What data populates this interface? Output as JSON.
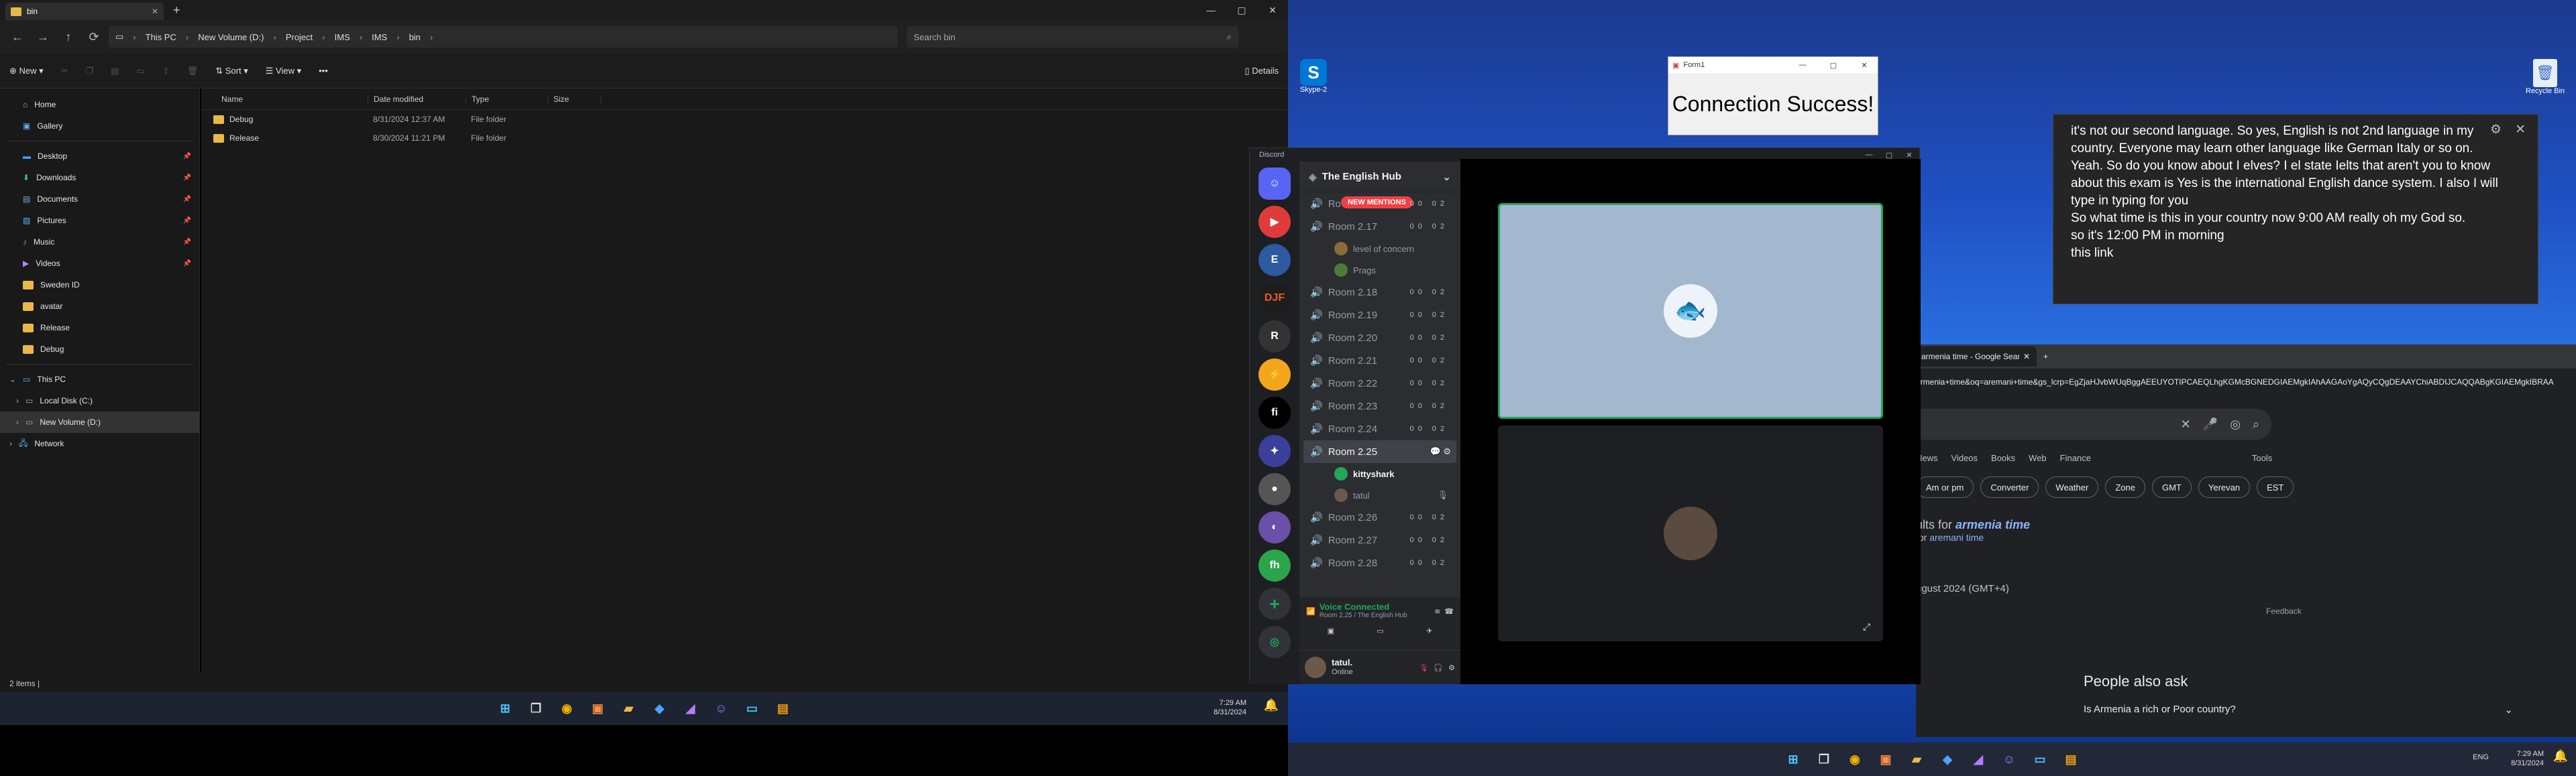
{
  "explorer": {
    "tab_title": "bin",
    "breadcrumbs": [
      "This PC",
      "New Volume (D:)",
      "Project",
      "IMS",
      "IMS",
      "bin"
    ],
    "search_placeholder": "Search bin",
    "toolbar": {
      "new": "New",
      "sort": "Sort",
      "view": "View",
      "more": "•••",
      "details": "Details"
    },
    "sidebar": {
      "top": [
        "Home",
        "Gallery"
      ],
      "pinned": [
        "Desktop",
        "Downloads",
        "Documents",
        "Pictures",
        "Music",
        "Videos"
      ],
      "folders": [
        "Sweden ID",
        "avatar",
        "Release",
        "Debug"
      ],
      "this_pc": "This PC",
      "drives": [
        "Local Disk (C:)",
        "New Volume (D:)"
      ],
      "network": "Network"
    },
    "columns": [
      "Name",
      "Date modified",
      "Type",
      "Size"
    ],
    "rows": [
      {
        "name": "Debug",
        "date": "8/31/2024 12:37 AM",
        "type": "File folder",
        "size": ""
      },
      {
        "name": "Release",
        "date": "8/30/2024 11:21 PM",
        "type": "File folder",
        "size": ""
      }
    ],
    "status": "2 items  |"
  },
  "taskbar_left": {
    "time": "7:29 AM",
    "date": "8/31/2024"
  },
  "taskbar_right": {
    "time": "7:29 AM",
    "date": "8/31/2024",
    "lang": "ENG"
  },
  "desktop": {
    "skype": "Skype-2",
    "recycle": "Recycle Bin"
  },
  "form1": {
    "title": "Form1",
    "message": "Connection Success!"
  },
  "notes": {
    "lines": [
      "it's not our second language. So yes, English is not 2nd language in my country. Everyone may learn other language like German Italy or so on. Yeah. So do you know about I elves? I el state Ielts that aren't you to know about this exam is Yes is the international English dance system. I also I will type in typing for you",
      "So what time is this in your country now 9:00 AM really oh my God so.",
      "so it's 12:00 PM in morning",
      "this link"
    ]
  },
  "discord": {
    "title": "Discord",
    "server": "The English Hub",
    "new_mentions": "NEW MENTIONS",
    "room_top": "Ro",
    "channels_a": [
      "Room 2.17"
    ],
    "users_a": [
      "level of concern",
      "Prags"
    ],
    "channels_b": [
      "Room 2.18",
      "Room 2.19",
      "Room 2.20",
      "Room 2.21",
      "Room 2.22",
      "Room 2.23",
      "Room 2.24"
    ],
    "active_channel": "Room 2.25",
    "users_b": [
      "kittyshark",
      "tatul"
    ],
    "channels_c": [
      "Room 2.26",
      "Room 2.27",
      "Room 2.28"
    ],
    "counts": "00 02",
    "voice_status": "Voice Connected",
    "voice_room": "Room 2.25 / The English Hub",
    "user_name": "tatul.",
    "user_status": "Online"
  },
  "chrome": {
    "tab_title": "armenia time - Google Search",
    "url": "armenia+time&oq=aremani+time&gs_lcrp=EgZjaHJvbWUqBggAEEUYOTIPCAEQLhgKGMcBGNEDGIAEMgkIAhAAGAoYgAQyCQgDEAAYChiABDIJCAQQABgKGIAEMgkIBRAA",
    "nav": [
      "News",
      "Videos",
      "Books",
      "Web",
      "Finance",
      "Tools"
    ],
    "chips": [
      "Am or pm",
      "Converter",
      "Weather",
      "Zone",
      "GMT",
      "Yerevan",
      "EST"
    ],
    "result_prefix": "ults for ",
    "result_term": "armenia time",
    "result_sub_prefix": "for ",
    "result_sub_term": "aremani time",
    "date_line": "ugust 2024 (GMT+4)",
    "feedback": "Feedback",
    "paa_title": "People also ask",
    "paa_q": "Is Armenia a rich or Poor country?"
  }
}
